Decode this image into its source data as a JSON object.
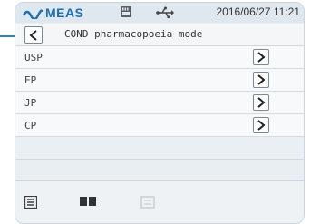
{
  "statusbar": {
    "brand": "MEAS",
    "datetime": "2016/06/27 11:21"
  },
  "header": {
    "title": "COND pharmacopoeia mode"
  },
  "list": {
    "items": [
      {
        "label": "USP"
      },
      {
        "label": "EP"
      },
      {
        "label": "JP"
      },
      {
        "label": "CP"
      }
    ]
  },
  "colors": {
    "brand": "#1e6fb3",
    "accent_line": "#2c86b8",
    "frame_bg": "#e8eef2"
  },
  "icons": {
    "logo": "wave-logo-icon",
    "sd": "sd-card-icon",
    "usb": "usb-icon",
    "back": "chevron-left-icon",
    "open": "chevron-right-icon",
    "list": "list-icon",
    "book": "book-icon",
    "disabled": "disabled-tool-icon"
  }
}
